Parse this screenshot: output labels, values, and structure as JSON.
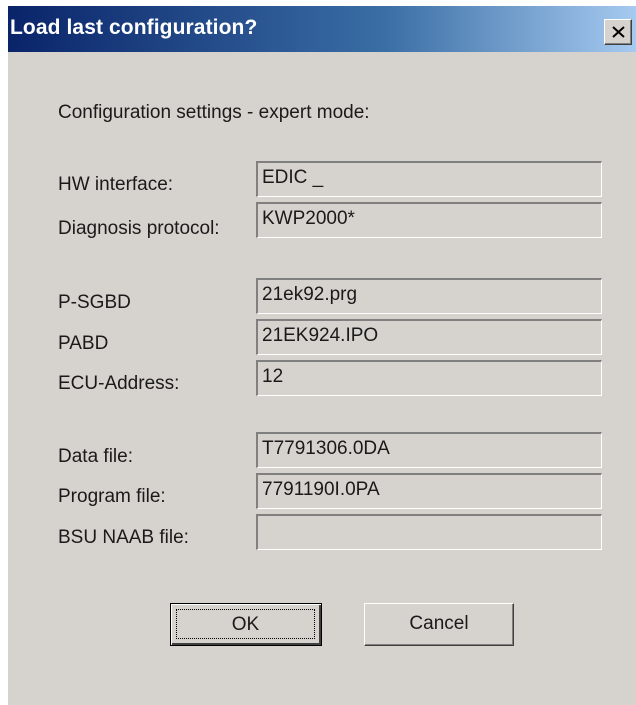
{
  "dialog": {
    "title": "Load last configuration?",
    "close_glyph": "×",
    "heading": "Configuration settings - expert mode:"
  },
  "fields": [
    {
      "label": "HW interface:",
      "value": "EDIC _"
    },
    {
      "label": "Diagnosis protocol:",
      "value": "KWP2000*"
    },
    {
      "label": "P-SGBD",
      "value": "21ek92.prg"
    },
    {
      "label": "PABD",
      "value": "21EK924.IPO"
    },
    {
      "label": "ECU-Address:",
      "value": "12"
    },
    {
      "label": "Data file:",
      "value": "T7791306.0DA"
    },
    {
      "label": "Program file:",
      "value": "7791190I.0PA"
    },
    {
      "label": "BSU NAAB file:",
      "value": ""
    }
  ],
  "buttons": {
    "ok_label": "OK",
    "cancel_label": "Cancel"
  },
  "colors": {
    "titlebar_start": "#0a246a",
    "titlebar_end": "#a6caf0",
    "dialog_face": "#d6d3ce"
  }
}
